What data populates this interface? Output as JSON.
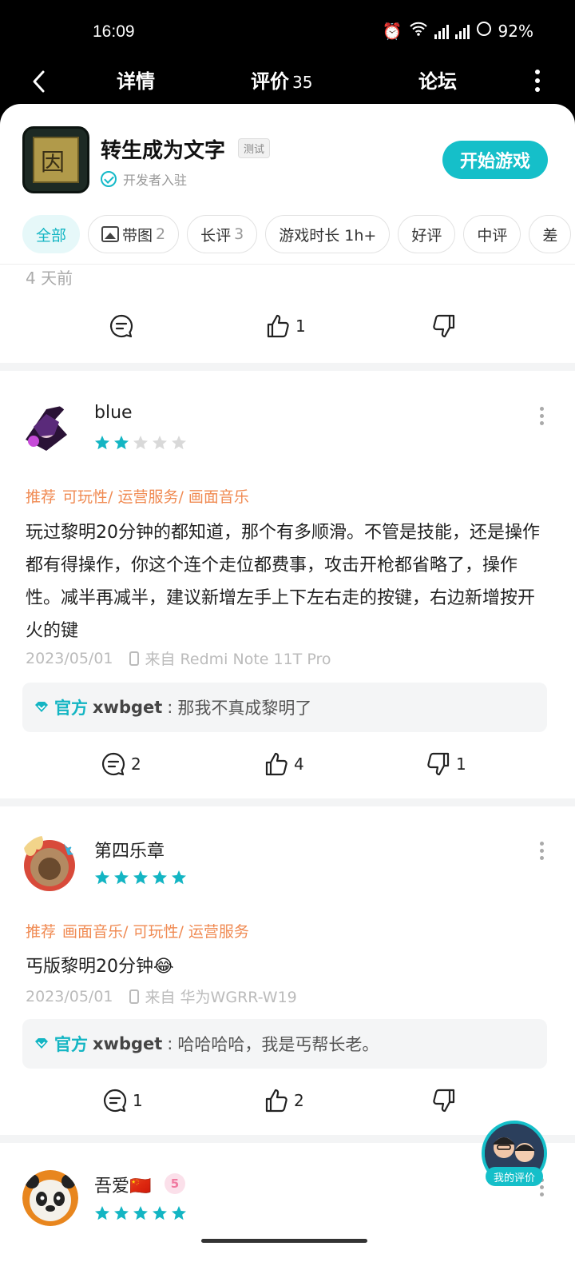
{
  "status_bar": {
    "time": "16:09",
    "battery": "92%"
  },
  "nav": {
    "tabs": [
      {
        "label": "详情",
        "count": ""
      },
      {
        "label": "评价",
        "count": "35"
      },
      {
        "label": "论坛",
        "count": ""
      }
    ]
  },
  "game": {
    "title": "转生成为文字",
    "tag": "测试",
    "developer_label": "开发者入驻",
    "icon_glyph": "因",
    "start_button": "开始游戏"
  },
  "filters": [
    {
      "label": "全部",
      "count": ""
    },
    {
      "label": "带图",
      "count": "2"
    },
    {
      "label": "长评",
      "count": "3"
    },
    {
      "label": "游戏时长 1h+",
      "count": ""
    },
    {
      "label": "好评",
      "count": ""
    },
    {
      "label": "中评",
      "count": ""
    },
    {
      "label": "差",
      "count": ""
    }
  ],
  "prev_review": {
    "time_ago": "4 天前",
    "likes": "1"
  },
  "reviews": [
    {
      "username": "blue",
      "rating": 2,
      "rec_label": "推荐",
      "tags": "可玩性/ 运营服务/ 画面音乐",
      "body": "玩过黎明20分钟的都知道，那个有多顺滑。不管是技能，还是操作都有得操作，你这个连个走位都费事，攻击开枪都省略了，操作性。减半再减半，建议新增左手上下左右走的按键，右边新增按开火的键",
      "date": "2023/05/01",
      "device": "来自 Redmi Note 11T Pro",
      "reply_official": "官方",
      "reply_author": "xwbget",
      "reply_text": "那我不真成黎明了",
      "comments": "2",
      "likes": "4",
      "dislikes": "1"
    },
    {
      "username": "第四乐章",
      "rating": 5,
      "rec_label": "推荐",
      "tags": "画面音乐/ 可玩性/ 运营服务",
      "body": "丐版黎明20分钟😂",
      "date": "2023/05/01",
      "device": "来自 华为WGRR-W19",
      "reply_official": "官方",
      "reply_author": "xwbget",
      "reply_text": "哈哈哈哈，我是丐帮长老。",
      "comments": "1",
      "likes": "2",
      "dislikes": ""
    },
    {
      "username": "吾爱🇨🇳",
      "level": "5",
      "rating": 5
    }
  ],
  "fab_label": "我的评价",
  "colors": {
    "accent": "#15bfc9",
    "star_on": "#13b5c3",
    "star_off": "#d9d9d9",
    "recommend": "#f08a52"
  }
}
